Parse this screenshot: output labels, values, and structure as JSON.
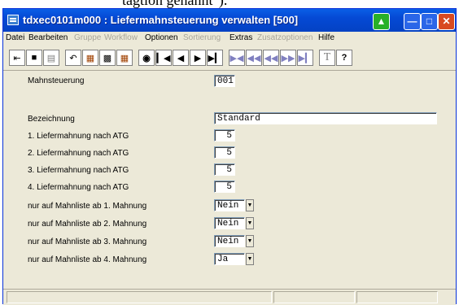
{
  "caption_fragment": "tagtion genannt\").",
  "window": {
    "title": "tdxec0101m000 : Liefermahnsteuerung verwalten [500]"
  },
  "menu": [
    {
      "label": "Datei",
      "enabled": true
    },
    {
      "label": "Bearbeiten",
      "enabled": true
    },
    {
      "label": "Gruppe",
      "enabled": false
    },
    {
      "label": "Workflow",
      "enabled": false
    },
    {
      "label": "Optionen",
      "enabled": true
    },
    {
      "label": "Sortierung",
      "enabled": false
    },
    {
      "label": "Extras",
      "enabled": true
    },
    {
      "label": "Zusatzoptionen",
      "enabled": false
    },
    {
      "label": "Hilfe",
      "enabled": true
    }
  ],
  "toolbar_icons": [
    "exit-icon",
    "save-icon",
    "print-icon",
    "undo-icon",
    "copy-record-icon",
    "paste-icon",
    "duplicate-icon",
    "find-icon",
    "first-record-icon",
    "previous-record-icon",
    "next-record-icon",
    "last-record-icon",
    "first-group-icon",
    "previous-group-icon",
    "previous-page-icon",
    "next-page-icon",
    "last-group-icon",
    "text-icon",
    "help-icon"
  ],
  "toolbar_glyphs": {
    "find": "⌂",
    "text": "T",
    "help": "?"
  },
  "form": {
    "mahnsteuerung": {
      "label": "Mahnsteuerung",
      "value": "001"
    },
    "bezeichnung": {
      "label": "Bezeichnung",
      "value": "Standard"
    },
    "mahnung1": {
      "label": "1. Liefermahnung nach ATG",
      "value": "5"
    },
    "mahnung2": {
      "label": "2. Liefermahnung nach ATG",
      "value": "5"
    },
    "mahnung3": {
      "label": "3. Liefermahnung nach ATG",
      "value": "5"
    },
    "mahnung4": {
      "label": "4. Liefermahnung nach ATG",
      "value": "5"
    },
    "liste1": {
      "label": "nur auf Mahnliste ab 1. Mahnung",
      "value": "Nein"
    },
    "liste2": {
      "label": "nur auf Mahnliste ab 2. Mahnung",
      "value": "Nein"
    },
    "liste3": {
      "label": "nur auf Mahnliste ab 3. Mahnung",
      "value": "Nein"
    },
    "liste4": {
      "label": "nur auf Mahnliste ab 4. Mahnung",
      "value": "Ja"
    }
  },
  "colors": {
    "titlebar": "#0549d4",
    "close_button": "#d84a22",
    "face": "#ece9d8"
  }
}
